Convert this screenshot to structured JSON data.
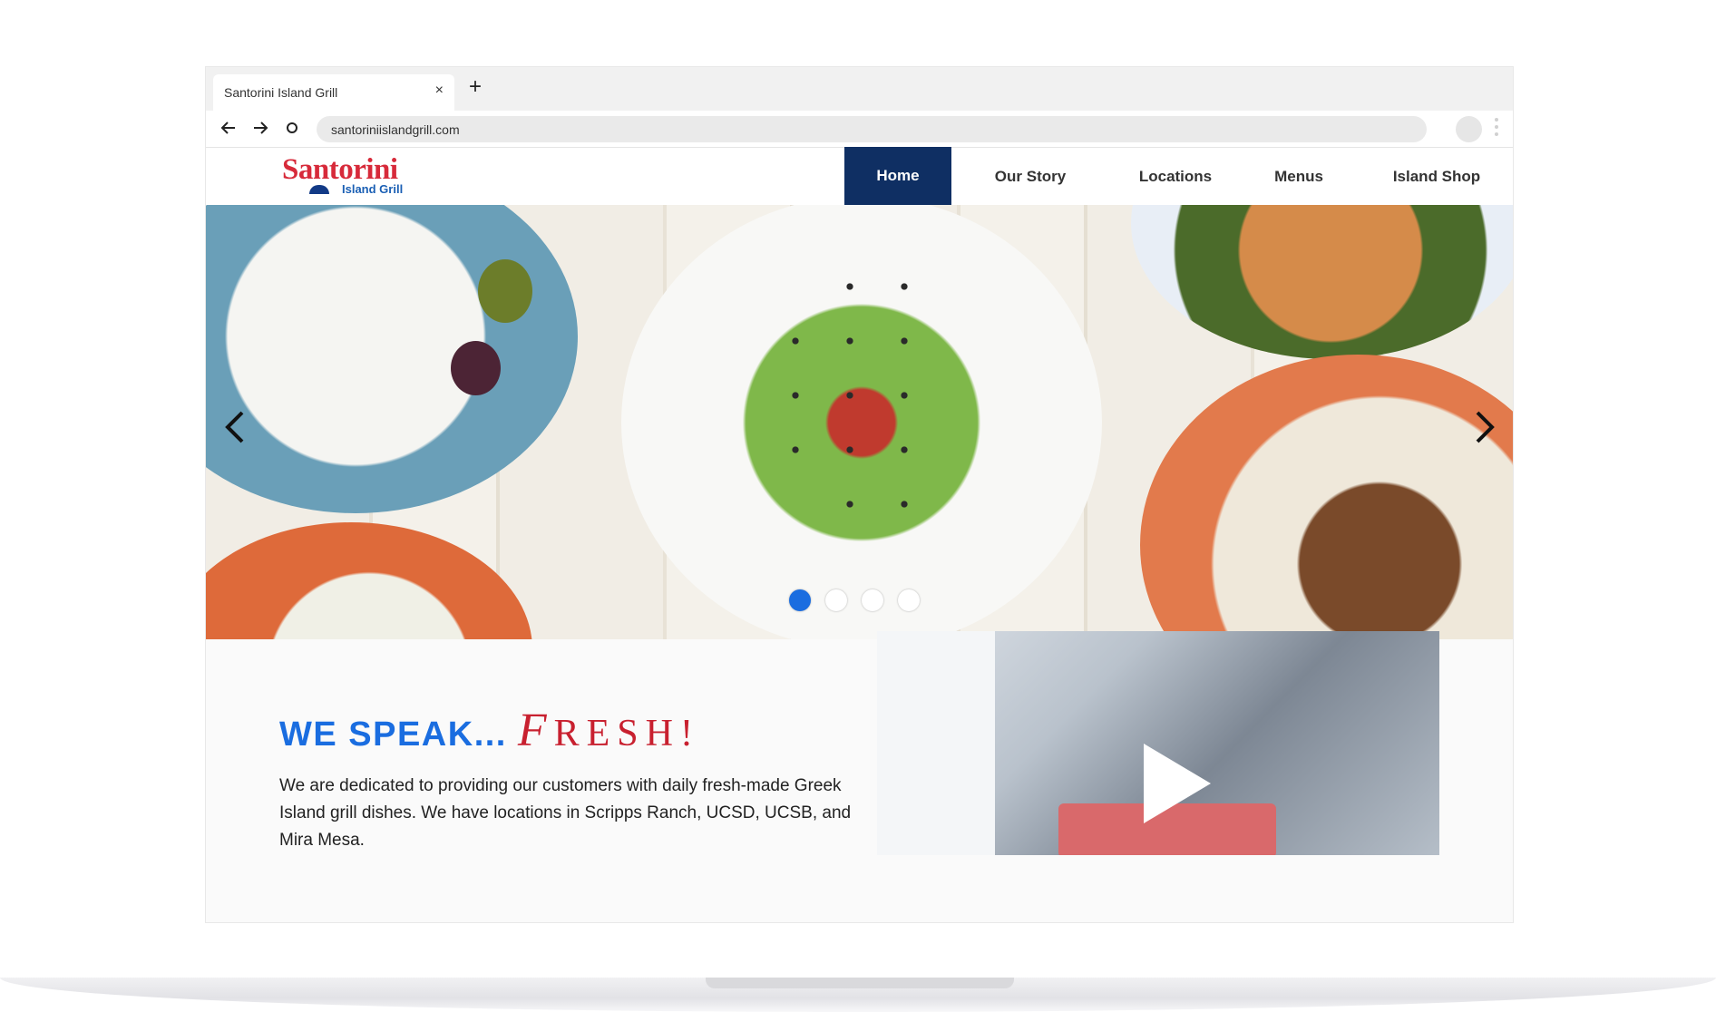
{
  "browser": {
    "tab_title": "Santorini Island Grill",
    "url": "santoriniislandgrill.com"
  },
  "logo": {
    "main": "Santorini",
    "sub": "Island Grill"
  },
  "nav": {
    "items": [
      {
        "label": "Home",
        "active": true
      },
      {
        "label": "Our Story",
        "active": false
      },
      {
        "label": "Locations",
        "active": false
      },
      {
        "label": "Menus",
        "active": false
      },
      {
        "label": "Island Shop",
        "active": false
      }
    ]
  },
  "hero": {
    "slide_count": 4,
    "active_slide": 1
  },
  "intro": {
    "headline_part1": "WE SPEAK...",
    "headline_cap": "F",
    "headline_rest": "RESH!",
    "description": "We are dedicated to providing our customers with daily fresh-made Greek Island grill dishes. We have locations in Scripps Ranch, UCSD, UCSB, and Mira Mesa."
  },
  "colors": {
    "brand_red": "#d72a3a",
    "brand_blue": "#1a6de0",
    "nav_active": "#0f2f63"
  }
}
